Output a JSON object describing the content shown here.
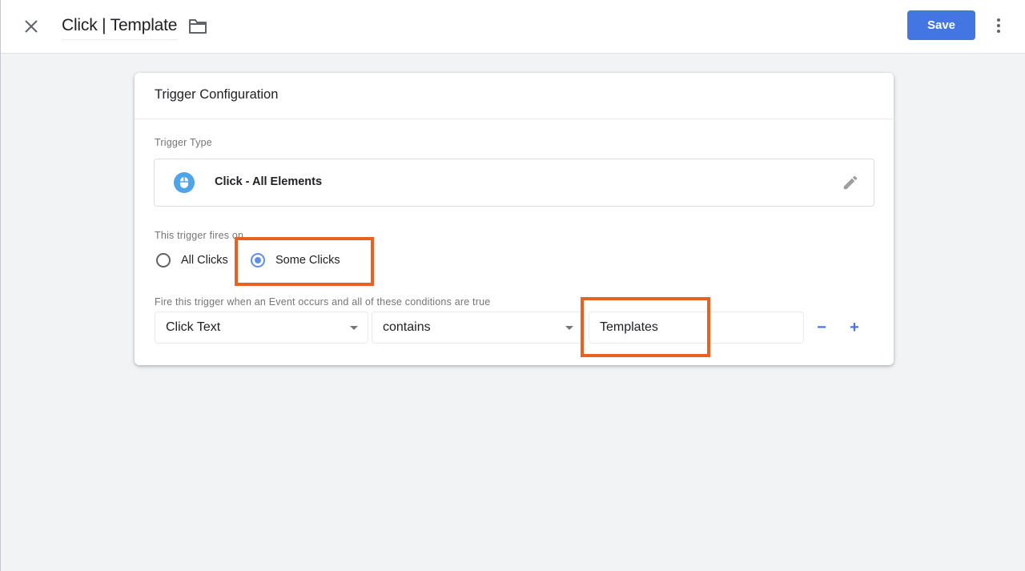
{
  "topbar": {
    "close_icon": "close-icon",
    "title": "Click | Template",
    "folder_icon": "folder-icon",
    "save_label": "Save",
    "more_icon": "more-vert-icon"
  },
  "card": {
    "title": "Trigger Configuration",
    "trigger_type": {
      "label": "Trigger Type",
      "icon": "mouse-icon",
      "name": "Click - All Elements",
      "edit_icon": "pencil-icon"
    },
    "fires_on": {
      "label": "This trigger fires on",
      "options": [
        {
          "label": "All Clicks",
          "checked": false
        },
        {
          "label": "Some Clicks",
          "checked": true
        }
      ]
    },
    "conditions": {
      "label": "Fire this trigger when an Event occurs and all of these conditions are true",
      "variable": "Click Text",
      "operator": "contains",
      "value": "Templates",
      "remove_label": "−",
      "add_label": "+"
    }
  },
  "colors": {
    "accent": "#4476e3",
    "highlight": "#e8621f",
    "radio_checked": "#5f8ee6",
    "background": "#f1f3f4"
  }
}
